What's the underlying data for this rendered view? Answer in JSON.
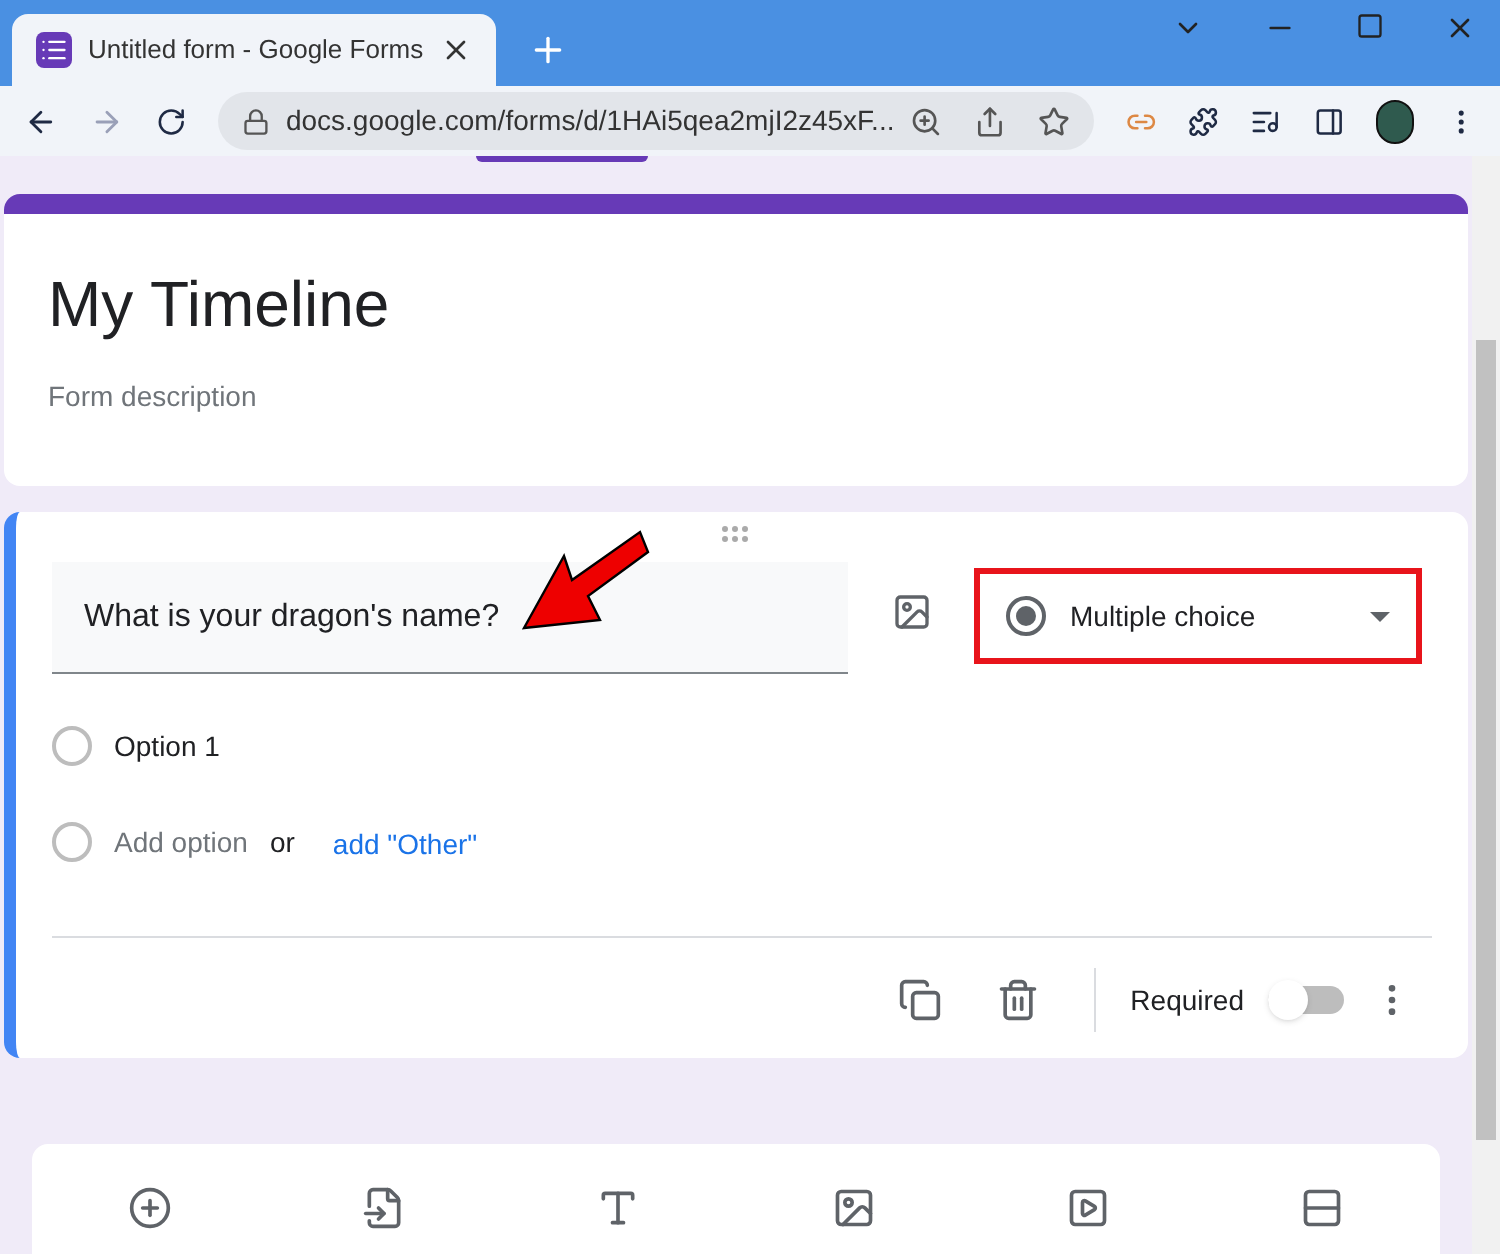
{
  "browser": {
    "tab": {
      "title": "Untitled form - Google Forms",
      "selected": true
    },
    "address": "docs.google.com/forms/d/1HAi5qea2mjI2z45xF..."
  },
  "form": {
    "title": "My Timeline",
    "description_placeholder": "Form description"
  },
  "question": {
    "title": "What is your dragon's name?",
    "type": "Multiple choice",
    "options": [
      {
        "label": "Option 1",
        "kind": "option",
        "selected": false
      },
      {
        "label": "Add option",
        "kind": "add",
        "selected": false
      }
    ],
    "or": "or",
    "add_other": "add \"Other\"",
    "required": {
      "label": "Required",
      "on": false
    }
  },
  "annotation": {
    "arrow": true,
    "highlight_type": true
  }
}
